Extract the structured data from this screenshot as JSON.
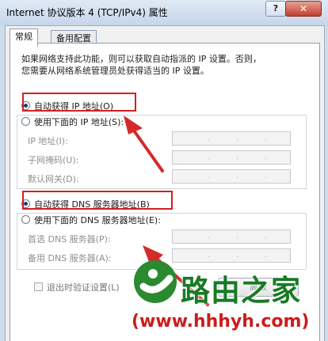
{
  "window": {
    "title": "Internet 协议版本 4 (TCP/IPv4) 属性",
    "help_glyph": "?",
    "close_glyph": "✕"
  },
  "tabs": [
    {
      "label": "常规",
      "active": true
    },
    {
      "label": "备用配置",
      "active": false
    }
  ],
  "description": [
    "如果网络支持此功能，则可以获取自动指派的 IP 设置。否则，",
    "您需要从网络系统管理员处获得适当的 IP 设置。"
  ],
  "ip_section": {
    "auto": {
      "label": "自动获得 IP 地址(O)",
      "checked": true
    },
    "manual": {
      "label": "使用下面的 IP 地址(S):",
      "checked": false
    },
    "fields": [
      {
        "label": "IP 地址(I):"
      },
      {
        "label": "子网掩码(U):"
      },
      {
        "label": "默认网关(D):"
      }
    ]
  },
  "dns_section": {
    "auto": {
      "label": "自动获得 DNS 服务器地址(B)",
      "checked": true
    },
    "manual": {
      "label": "使用下面的 DNS 服务器地址(E):",
      "checked": false
    },
    "fields": [
      {
        "label": "首选 DNS 服务器(P):"
      },
      {
        "label": "备用 DNS 服务器(A):"
      }
    ]
  },
  "validate_checkbox": {
    "label": "退出时验证设置(L)",
    "checked": false
  },
  "advanced_button": {
    "label": "高级"
  },
  "watermark": {
    "brand": "路由之家",
    "url": "(www.hhhyh.com)",
    "logo_color": "#2a8a2f",
    "text_color": "#cc1c1c"
  },
  "colors": {
    "highlight": "#cf2020",
    "arrow": "#d42a2a"
  }
}
